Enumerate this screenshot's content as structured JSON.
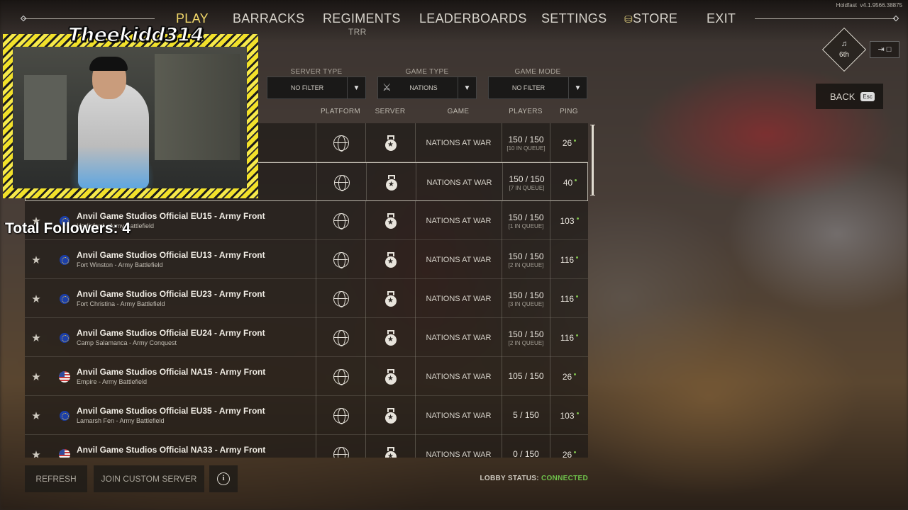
{
  "app": {
    "version_label": "Holdfast",
    "version": "v4.1.9566.38875"
  },
  "nav": {
    "play": "PLAY",
    "barracks": "BARRACKS",
    "regiments": "REGIMENTS",
    "regiments_sub": "TRR",
    "leaderboards": "LEADERBOARDS",
    "settings": "SETTINGS",
    "store": "STORE",
    "exit": "EXIT"
  },
  "rank": {
    "label": "6th"
  },
  "back": {
    "label": "BACK",
    "key": "Esc"
  },
  "filters": {
    "server_type": {
      "label": "SERVER TYPE",
      "value": "NO FILTER"
    },
    "game_type": {
      "label": "GAME TYPE",
      "value": "NATIONS"
    },
    "game_mode": {
      "label": "GAME MODE",
      "value": "NO FILTER"
    }
  },
  "headers": {
    "platform": "PLATFORM",
    "server": "SERVER",
    "game": "GAME",
    "players": "PLAYERS",
    "ping": "PING"
  },
  "rows": [
    {
      "name": "",
      "sub": "",
      "flag": "",
      "game": "NATIONS AT WAR",
      "players": "150 / 150",
      "queue": "[10 IN QUEUE]",
      "ping": "26"
    },
    {
      "name": "",
      "sub": "",
      "flag": "",
      "game": "NATIONS AT WAR",
      "players": "150 / 150",
      "queue": "[7 IN QUEUE]",
      "ping": "40"
    },
    {
      "name": "Anvil Game Studios Official EU15 - Army Front",
      "sub": "Hadisford - Army Battlefield",
      "flag": "eu",
      "game": "NATIONS AT WAR",
      "players": "150 / 150",
      "queue": "[1 IN QUEUE]",
      "ping": "103"
    },
    {
      "name": "Anvil Game Studios Official EU13 - Army Front",
      "sub": "Fort Winston - Army Battlefield",
      "flag": "eu",
      "game": "NATIONS AT WAR",
      "players": "150 / 150",
      "queue": "[2 IN QUEUE]",
      "ping": "116"
    },
    {
      "name": "Anvil Game Studios Official EU23 - Army Front",
      "sub": "Fort Christina - Army Battlefield",
      "flag": "eu",
      "game": "NATIONS AT WAR",
      "players": "150 / 150",
      "queue": "[3 IN QUEUE]",
      "ping": "116"
    },
    {
      "name": "Anvil Game Studios Official EU24 - Army Front",
      "sub": "Camp Salamanca - Army Conquest",
      "flag": "eu",
      "game": "NATIONS AT WAR",
      "players": "150 / 150",
      "queue": "[2 IN QUEUE]",
      "ping": "116"
    },
    {
      "name": "Anvil Game Studios Official NA15 - Army Front",
      "sub": "Empire - Army Battlefield",
      "flag": "us",
      "game": "NATIONS AT WAR",
      "players": "105 / 150",
      "queue": "",
      "ping": "26"
    },
    {
      "name": "Anvil Game Studios Official EU35 - Army Front",
      "sub": "Lamarsh Fen - Army Battlefield",
      "flag": "eu",
      "game": "NATIONS AT WAR",
      "players": "5 / 150",
      "queue": "",
      "ping": "103"
    },
    {
      "name": "Anvil Game Studios Official NA33 - Army Front",
      "sub": "",
      "flag": "us",
      "game": "NATIONS AT WAR",
      "players": "0 / 150",
      "queue": "",
      "ping": "26"
    }
  ],
  "bottom": {
    "refresh": "REFRESH",
    "join_custom": "JOIN CUSTOM SERVER",
    "info": "i",
    "lobby_label": "LOBBY STATUS:",
    "lobby_status": "CONNECTED"
  },
  "overlay": {
    "streamer_name": "Theekidd314",
    "followers": "Total Followers: 4"
  },
  "colors": {
    "active_nav": "#f2d86a",
    "connected": "#6fc24b",
    "cam_border": "#f2e12a"
  },
  "icons": {
    "platform": "globe-icon",
    "server": "medal-icon",
    "favorite": "star-icon",
    "store": "coins-icon"
  }
}
